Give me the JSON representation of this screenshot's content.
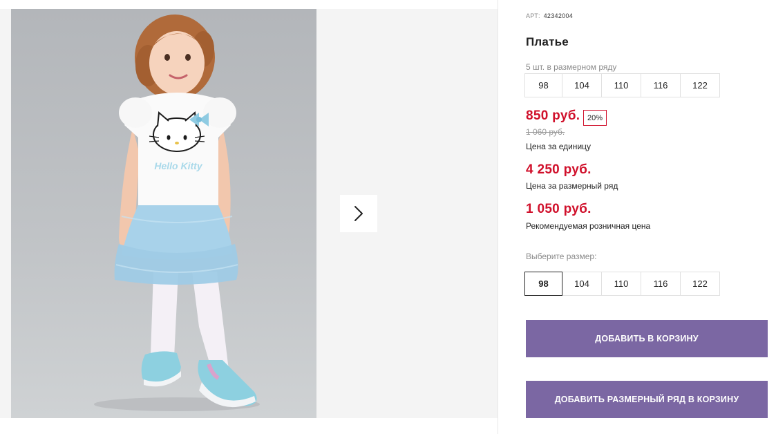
{
  "product": {
    "art_label": "АРТ:",
    "art_value": "42342004",
    "title": "Платье",
    "image_alt": "Девочка в платье Hello Kitty",
    "print_text": "Hello Kitty"
  },
  "pack": {
    "note": "5 шт. в размерном ряду",
    "sizes": [
      "98",
      "104",
      "110",
      "116",
      "122"
    ]
  },
  "prices": {
    "unit_price": "850 руб.",
    "discount": "20%",
    "old_price": "1 060 руб.",
    "unit_caption": "Цена за единицу",
    "pack_price": "4 250 руб.",
    "pack_caption": "Цена за размерный ряд",
    "rrp_price": "1 050 руб.",
    "rrp_caption": "Рекомендуемая розничная цена"
  },
  "size_select": {
    "label": "Выберите размер:",
    "options": [
      "98",
      "104",
      "110",
      "116",
      "122"
    ],
    "selected": "98"
  },
  "buttons": {
    "add_to_cart": "ДОБАВИТЬ В КОРЗИНУ",
    "add_pack_to_cart": "ДОБАВИТЬ РАЗМЕРНЫЙ РЯД В КОРЗИНУ"
  },
  "colors": {
    "accent_price": "#d0102b",
    "button_bg": "#7b67a3",
    "gallery_bg": "#f4f4f4"
  },
  "icons": {
    "gallery_next": "chevron-right-icon"
  }
}
